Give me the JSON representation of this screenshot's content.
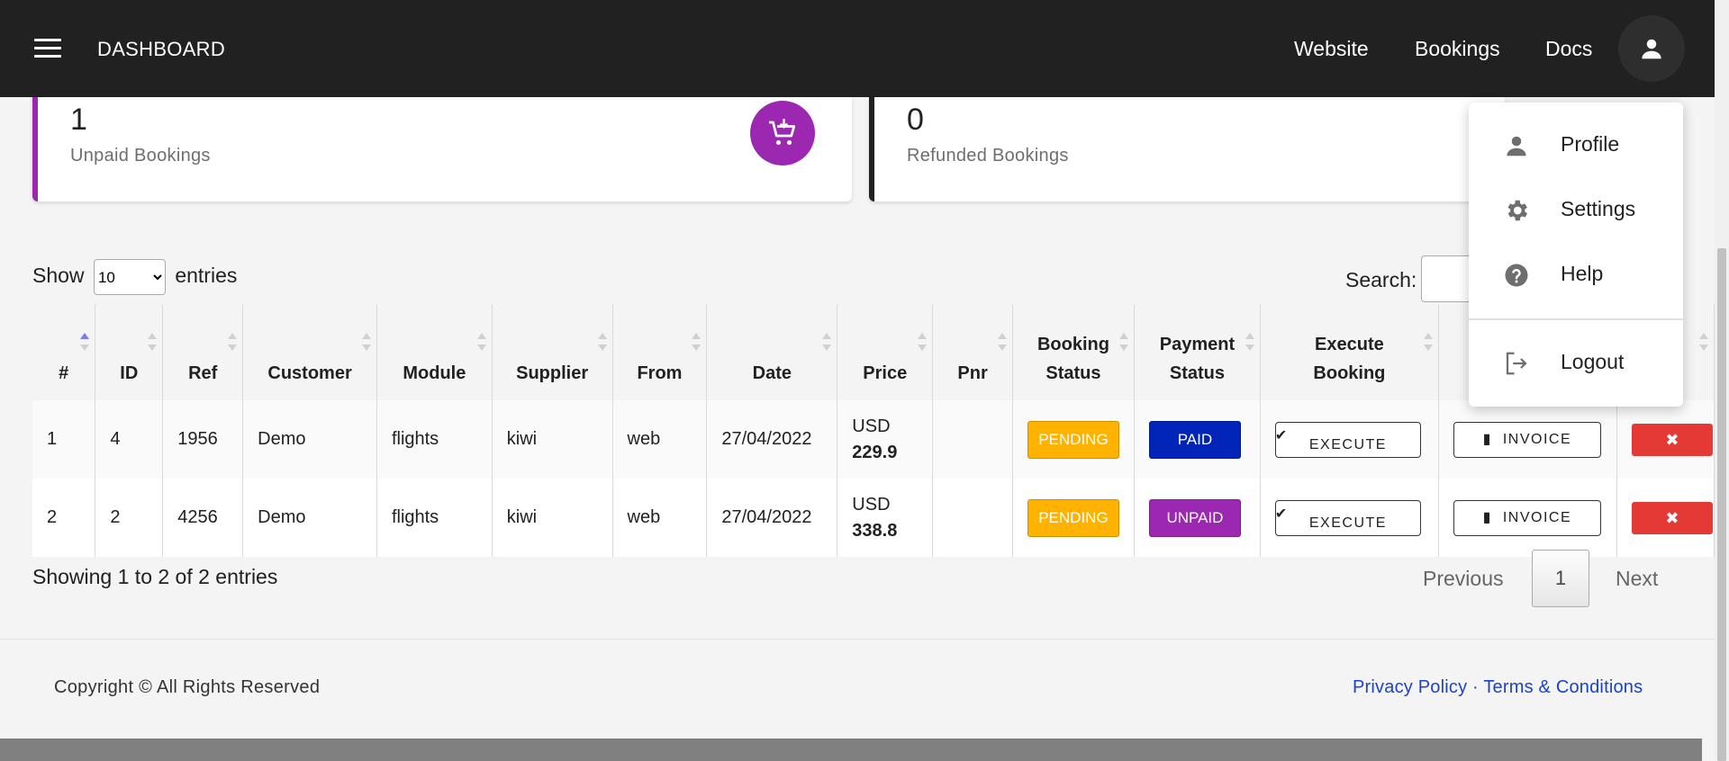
{
  "topbar": {
    "brand": "DASHBOARD",
    "nav": [
      "Website",
      "Bookings",
      "Docs"
    ]
  },
  "cards": [
    {
      "value": "1",
      "label": "Unpaid Bookings",
      "accent": "#9c27b0",
      "icon": "cart-icon"
    },
    {
      "value": "0",
      "label": "Refunded Bookings",
      "accent": "#212121"
    }
  ],
  "table_controls": {
    "show_label": "Show",
    "entries_label": "entries",
    "page_length": "10",
    "search_label": "Search:"
  },
  "table": {
    "headers": [
      {
        "line1": "#",
        "line2": ""
      },
      {
        "line1": "ID",
        "line2": ""
      },
      {
        "line1": "Ref",
        "line2": ""
      },
      {
        "line1": "Customer",
        "line2": ""
      },
      {
        "line1": "Module",
        "line2": ""
      },
      {
        "line1": "Supplier",
        "line2": ""
      },
      {
        "line1": "From",
        "line2": ""
      },
      {
        "line1": "Date",
        "line2": ""
      },
      {
        "line1": "Price",
        "line2": ""
      },
      {
        "line1": "Pnr",
        "line2": ""
      },
      {
        "line1": "Booking",
        "line2": "Status"
      },
      {
        "line1": "Payment",
        "line2": "Status"
      },
      {
        "line1": "Execute",
        "line2": "Booking"
      }
    ],
    "rows": [
      {
        "num": "1",
        "id": "4",
        "ref": "1956",
        "customer": "Demo",
        "module": "flights",
        "supplier": "kiwi",
        "from": "web",
        "date": "27/04/2022",
        "currency": "USD",
        "price": "229.9",
        "pnr": "",
        "booking_status": "PENDING",
        "payment_status": "PAID",
        "execute": "EXECUTE",
        "invoice": "INVOICE",
        "delete": "✖"
      },
      {
        "num": "2",
        "id": "2",
        "ref": "4256",
        "customer": "Demo",
        "module": "flights",
        "supplier": "kiwi",
        "from": "web",
        "date": "27/04/2022",
        "currency": "USD",
        "price": "338.8",
        "pnr": "",
        "booking_status": "PENDING",
        "payment_status": "UNPAID",
        "execute": "EXECUTE",
        "invoice": "INVOICE",
        "delete": "✖"
      }
    ]
  },
  "pagination": {
    "info": "Showing 1 to 2 of 2 entries",
    "previous": "Previous",
    "current_page": "1",
    "next": "Next"
  },
  "footer": {
    "copyright": "Copyright © All Rights Reserved",
    "privacy": "Privacy Policy",
    "separator": "·",
    "terms": "Terms & Conditions"
  },
  "user_menu": {
    "items": [
      {
        "label": "Profile",
        "icon": "person-icon"
      },
      {
        "label": "Settings",
        "icon": "gear-icon"
      },
      {
        "label": "Help",
        "icon": "help-icon"
      },
      {
        "label": "Logout",
        "icon": "logout-icon"
      }
    ]
  },
  "colors": {
    "topbar": "#212121",
    "pending": "#ffb300",
    "paid": "#0025b8",
    "unpaid": "#9c27b0",
    "delete": "#e53935",
    "link": "#1a43c9"
  }
}
